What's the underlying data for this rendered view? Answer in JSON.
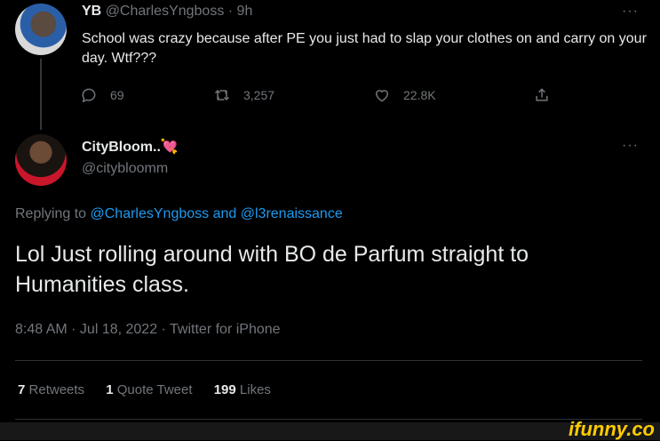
{
  "parent_tweet": {
    "display_name": "YB",
    "handle": "@CharlesYngboss",
    "time": "· 9h",
    "more": "···",
    "text": "School was crazy because after PE you just had to slap your clothes on and carry on your day. Wtf???",
    "actions": {
      "replies": "69",
      "retweets": "3,257",
      "likes": "22.8K"
    }
  },
  "reply_tweet": {
    "display_name": "CityBloom..",
    "emoji": "💘",
    "handle": "@citybloomm",
    "more": "···",
    "replying_prefix": "Replying to",
    "replying_user1": "@CharlesYngboss",
    "replying_and": "and",
    "replying_user2": "@l3renaissance",
    "text": "Lol Just rolling around with BO de Parfum straight to Humanities class.",
    "timestamp": "8:48 AM · Jul 18, 2022 · Twitter for iPhone",
    "stats": {
      "retweets_count": "7",
      "retweets_label": "Retweets",
      "quotes_count": "1",
      "quotes_label": "Quote Tweet",
      "likes_count": "199",
      "likes_label": "Likes"
    }
  },
  "watermark": "ifunny.co"
}
